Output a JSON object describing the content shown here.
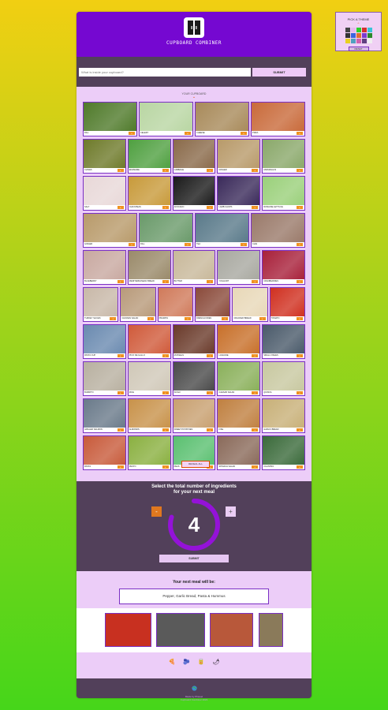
{
  "theme_picker": {
    "title": "PICK A THEME",
    "button": "RESET",
    "swatches": [
      "#444444",
      "#e6b8f0",
      "#2ad02a",
      "#d43030",
      "#3ac4d8",
      "#333333",
      "#3a64e0",
      "#e07030",
      "#7a3ad0",
      "#2a8a2a",
      "#e8d020",
      "#50a0c0",
      "#d060b0",
      "#604080",
      "#f0f0f0"
    ]
  },
  "header": {
    "logo_text": "CUPBOARD COMBINER"
  },
  "search": {
    "placeholder": "What is inside your cupboard?",
    "submit_label": "SUBMIT"
  },
  "cupboard": {
    "heading": "YOUR CUPBOARD",
    "reveal_label": "REVEAL ALL",
    "add_label": "+",
    "rows": [
      [
        {
          "label": "dill",
          "color": "#4f7a2a"
        },
        {
          "label": "celery",
          "color": "#b9d6a3"
        },
        {
          "label": "cheese",
          "color": "#a88a5a"
        },
        {
          "label": "pizza",
          "color": "#c96a3a"
        }
      ],
      [
        {
          "label": "chives",
          "color": "#6e7a2a"
        },
        {
          "label": "edamame",
          "color": "#4fa040"
        },
        {
          "label": "cabbage",
          "color": "#8a6a4a"
        },
        {
          "label": "ginger",
          "color": "#b89a6a"
        },
        {
          "label": "asparagus",
          "color": "#8aa86a"
        }
      ],
      [
        {
          "label": "salt",
          "color": "#e8d8d8"
        },
        {
          "label": "chickpeas",
          "color": "#c89a3a"
        },
        {
          "label": "avocado",
          "color": "#1a1a1a"
        },
        {
          "label": "lamb chops",
          "color": "#3a2a5a"
        },
        {
          "label": "romaine lettuce",
          "color": "#9ad07a"
        }
      ],
      [
        {
          "label": "ginger",
          "color": "#b89a6a"
        },
        {
          "label": "dill",
          "color": "#6a9a6a"
        },
        {
          "label": "tea",
          "color": "#5a7a8a"
        },
        {
          "label": "chai",
          "color": "#9a7a6a"
        }
      ],
      [
        {
          "label": "blueberry",
          "color": "#c8a8a0"
        },
        {
          "label": "mediterranean bread",
          "color": "#9a8a6a"
        },
        {
          "label": "butter",
          "color": "#c8b89a"
        },
        {
          "label": "yoghurt",
          "color": "#a8a8a0"
        },
        {
          "label": "cranberries",
          "color": "#a8203a"
        }
      ],
      [
        {
          "label": "turkey slices",
          "color": "#c8b8a8"
        },
        {
          "label": "chicken salad",
          "color": "#b89a7a"
        },
        {
          "label": "prawns",
          "color": "#d07a5a"
        },
        {
          "label": "french fries",
          "color": "#8a4a3a"
        },
        {
          "label": "cracker bread",
          "color": "#e8d8b8"
        },
        {
          "label": "tomato",
          "color": "#d03020"
        }
      ],
      [
        {
          "label": "pasta cup",
          "color": "#6a8ab0"
        },
        {
          "label": "pico de gallo",
          "color": "#d05a3a"
        },
        {
          "label": "mussels",
          "color": "#6a3a2a"
        },
        {
          "label": "lasagne",
          "color": "#c8702a"
        },
        {
          "label": "small fishes",
          "color": "#4a5a6a"
        }
      ],
      [
        {
          "label": "burrito",
          "color": "#b8b0a0"
        },
        {
          "label": "rice",
          "color": "#d0c8b8"
        },
        {
          "label": "sushi",
          "color": "#4a4a4a"
        },
        {
          "label": "caesar salad",
          "color": "#8ab05a"
        },
        {
          "label": "quinoa",
          "color": "#c8c8a0"
        }
      ],
      [
        {
          "label": "grilled salmon",
          "color": "#6a7a8a"
        },
        {
          "label": "almonds",
          "color": "#c8924a"
        },
        {
          "label": "sweet potatoes",
          "color": "#c8a070"
        },
        {
          "label": "fish",
          "color": "#c08040"
        },
        {
          "label": "garlic bread",
          "color": "#c8b078"
        }
      ],
      [
        {
          "label": "pasta",
          "color": "#c85a3a"
        },
        {
          "label": "pesto",
          "color": "#8ab040"
        },
        {
          "label": "peas",
          "color": "#5ac070"
        },
        {
          "label": "spinach salad",
          "color": "#8a6a5a"
        },
        {
          "label": "cilantro",
          "color": "#3a6a3a"
        }
      ]
    ]
  },
  "picker": {
    "title_line1": "Select the total number of ingredients",
    "title_line2": "for your next meal",
    "minus_label": "-",
    "plus_label": "+",
    "count": "4",
    "count_fraction": 0.8,
    "submit_label": "SUBMIT"
  },
  "result": {
    "title": "Your next meal will be:",
    "meal": "Pepper, Garlic Bread, Pasta & Hummus",
    "images": [
      {
        "name": "tomato",
        "color": "#c83020"
      },
      {
        "name": "small-fishes",
        "color": "#5a5a5a"
      },
      {
        "name": "pasta",
        "color": "#b8583a"
      },
      {
        "name": "spinach-salad",
        "color": "#8a7a5a"
      }
    ]
  },
  "footer_icons": [
    "🍕",
    "🫐",
    "🥫",
    "🌶"
  ],
  "footer": {
    "line1": "Made by Phiesel",
    "line2": "Cupboard Combiner 2022"
  }
}
